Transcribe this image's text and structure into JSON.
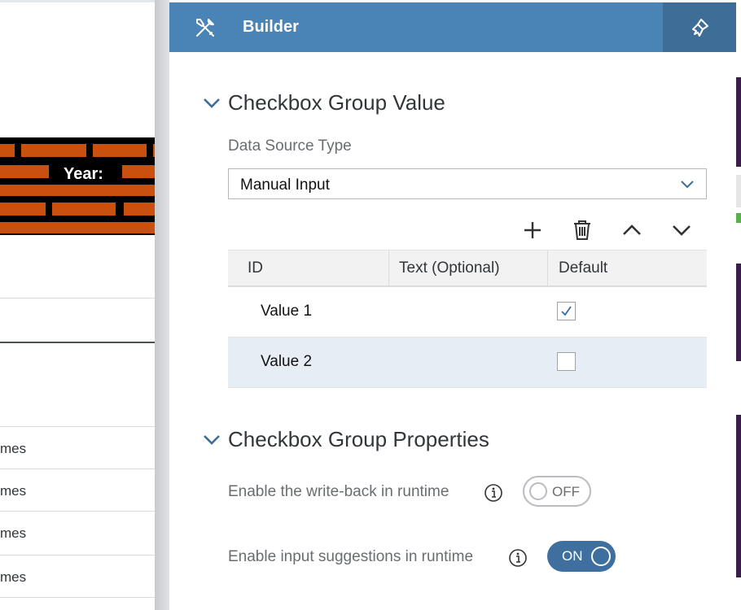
{
  "background": {
    "banner_text": "Year:",
    "row_texts": [
      "mes",
      "mes",
      "mes",
      "mes"
    ]
  },
  "header": {
    "title": "Builder",
    "tools_icon": "wrench-screwdriver-icon",
    "styling_icon": "paint-brush-icon"
  },
  "value_section": {
    "title": "Checkbox Group Value",
    "data_source_label": "Data Source Type",
    "data_source_value": "Manual Input",
    "toolbar": [
      "add-icon",
      "delete-icon",
      "move-up-icon",
      "move-down-icon"
    ],
    "columns": [
      "ID",
      "Text (Optional)",
      "Default"
    ],
    "rows": [
      {
        "id": "Value 1",
        "text": "",
        "default": true,
        "selected": false
      },
      {
        "id": "Value 2",
        "text": "",
        "default": false,
        "selected": true
      }
    ]
  },
  "properties_section": {
    "title": "Checkbox Group Properties",
    "write_back": {
      "label": "Enable the write-back in runtime",
      "state": "OFF"
    },
    "suggestions": {
      "label": "Enable input suggestions in runtime",
      "state": "ON"
    }
  },
  "colors": {
    "header": "#4a83b5",
    "header_button": "#3e6d97",
    "switch_on": "#3e6f9e",
    "selected_row": "#e6edf5",
    "brick": "#c9500f"
  }
}
